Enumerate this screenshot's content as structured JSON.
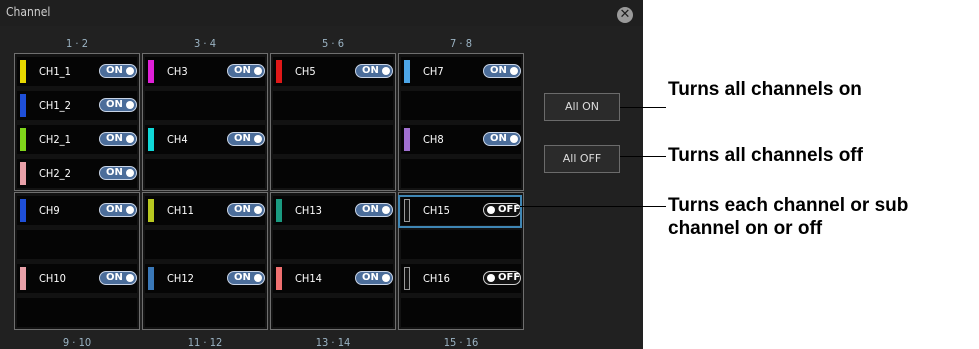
{
  "dialog": {
    "title": "Channel",
    "close_icon": "close-icon"
  },
  "top_headers": [
    "1 · 2",
    "3 · 4",
    "5 · 6",
    "7 · 8"
  ],
  "bottom_headers": [
    "9 · 10",
    "11 · 12",
    "13 · 14",
    "15 · 16"
  ],
  "groups": [
    [
      {
        "label": "CH1_1",
        "state": "ON",
        "color": "#e8d800"
      },
      {
        "label": "CH1_2",
        "state": "ON",
        "color": "#1e4fd8"
      },
      {
        "label": "CH2_1",
        "state": "ON",
        "color": "#7fd51a"
      },
      {
        "label": "CH2_2",
        "state": "ON",
        "color": "#e8a0a8"
      }
    ],
    [
      {
        "label": "CH3",
        "state": "ON",
        "color": "#e020d8"
      },
      null,
      {
        "label": "CH4",
        "state": "ON",
        "color": "#10d8d8"
      },
      null
    ],
    [
      {
        "label": "CH5",
        "state": "ON",
        "color": "#e01818"
      },
      null,
      null,
      null
    ],
    [
      {
        "label": "CH7",
        "state": "ON",
        "color": "#4da6e8"
      },
      null,
      {
        "label": "CH8",
        "state": "ON",
        "color": "#a070d0"
      },
      null
    ],
    [
      {
        "label": "CH9",
        "state": "ON",
        "color": "#1e4fd8"
      },
      null,
      {
        "label": "CH10",
        "state": "ON",
        "color": "#e8a0a8"
      },
      null
    ],
    [
      {
        "label": "CH11",
        "state": "ON",
        "color": "#b8c820"
      },
      null,
      {
        "label": "CH12",
        "state": "ON",
        "color": "#3a78b8"
      },
      null
    ],
    [
      {
        "label": "CH13",
        "state": "ON",
        "color": "#1a9a80"
      },
      null,
      {
        "label": "CH14",
        "state": "ON",
        "color": "#f07070"
      },
      null
    ],
    [
      {
        "label": "CH15",
        "state": "OFF",
        "color": "#111111"
      },
      null,
      {
        "label": "CH16",
        "state": "OFF",
        "color": "#111111"
      },
      null
    ]
  ],
  "buttons": {
    "all_on": "All ON",
    "all_off": "All OFF"
  },
  "callouts": {
    "all_on": "Turns all channels on",
    "all_off": "Turns all channels off",
    "each_line1": "Turns each channel or sub",
    "each_line2": "channel on or off"
  }
}
